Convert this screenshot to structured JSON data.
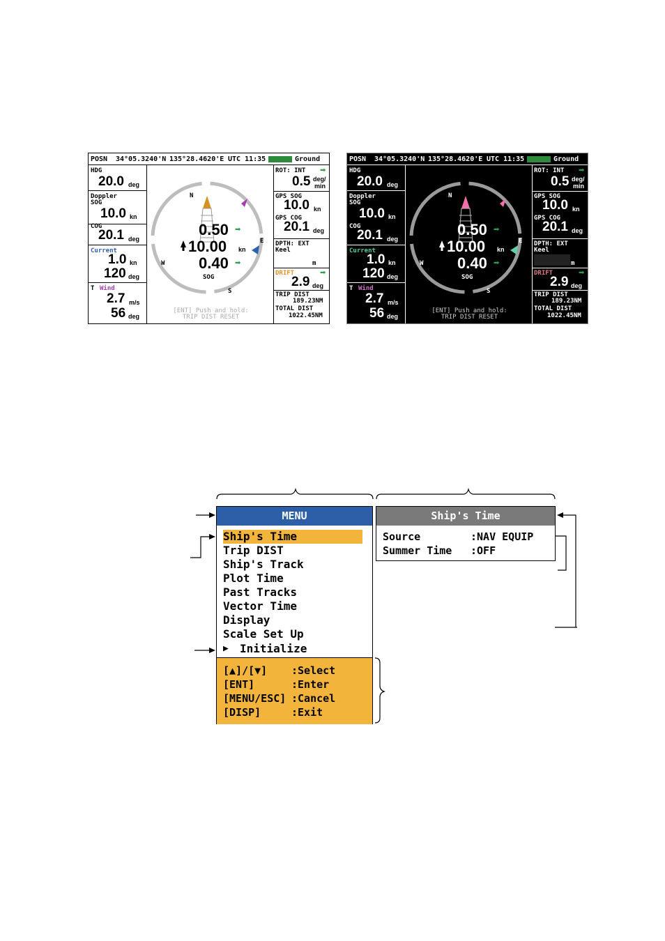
{
  "header": {
    "posn_label": "POSN",
    "lat": "34°05.3240'N",
    "lon": "135°28.4620'E",
    "utc": "UTC 11:35",
    "mode": "Ground"
  },
  "left_panel": {
    "hdg": {
      "label": "HDG",
      "value": "20.0",
      "unit": "deg"
    },
    "doppler_sog": {
      "label1": "Doppler",
      "label2": "SOG",
      "value": "10.0",
      "unit": "kn"
    },
    "cog": {
      "label": "COG",
      "value": "20.1",
      "unit": "deg"
    },
    "current": {
      "label": "Current",
      "speed": "1.0",
      "speed_unit": "kn",
      "dir": "120",
      "dir_unit": "deg"
    },
    "t_wind": {
      "label_t": "T",
      "label_wind": "Wind",
      "speed": "2.7",
      "speed_unit": "m/s",
      "dir": "56",
      "dir_unit": "deg"
    }
  },
  "compass": {
    "n": "N",
    "e": "E",
    "s": "S",
    "w": "W",
    "v1": "0.50",
    "v2": "10.00",
    "v2_unit": "kn",
    "v3": "0.40",
    "sog_label": "SOG",
    "note1": "[ENT] Push and hold:",
    "note2": "TRIP DIST RESET"
  },
  "right_panel": {
    "rot": {
      "label": "ROT: INT",
      "value": "0.5",
      "unit_top": "deg/",
      "unit_bottom": "min"
    },
    "gps_sog": {
      "label": "GPS SOG",
      "value": "10.0",
      "unit": "kn"
    },
    "gps_cog": {
      "label": "GPS COG",
      "value": "20.1",
      "unit": "deg"
    },
    "dpth": {
      "label": "DPTH: EXT",
      "sub": "Keel",
      "unit": "m"
    },
    "drift": {
      "label": "DRIFT",
      "value": "2.9",
      "unit": "deg"
    },
    "trip": {
      "label": "TRIP DIST",
      "value": "189.23NM"
    },
    "total": {
      "label": "TOTAL DIST",
      "value": "1022.45NM"
    }
  },
  "menu": {
    "title": "MENU",
    "items": [
      "Ship's Time",
      "Trip DIST",
      "Ship's Track",
      "Plot Time",
      "Past Tracks",
      "Vector Time",
      "Display",
      "Scale Set Up",
      "Initialize"
    ],
    "help": [
      {
        "key": "[▲]/[▼]",
        "action": ":Select"
      },
      {
        "key": "[ENT]",
        "action": ":Enter"
      },
      {
        "key": "[MENU/ESC]",
        "action": ":Cancel"
      },
      {
        "key": "[DISP]",
        "action": ":Exit"
      }
    ]
  },
  "submenu": {
    "title": "Ship's Time",
    "rows": [
      {
        "key": "Source",
        "value": ":NAV EQUIP"
      },
      {
        "key": "Summer Time",
        "value": ":OFF"
      }
    ]
  },
  "colors": {
    "menu_title_bg": "#2c5fa8",
    "menu_highlight": "#f2b43a",
    "submenu_title_bg": "#7a7a7a",
    "ground_bar": "#2e8b3e",
    "green_arrow": "#2ea04a",
    "current_day": "#2f5fb0",
    "current_night": "#4ad29a",
    "wind": "#a040a8",
    "drift_day": "#e0922c",
    "drift_night": "#e07a7a"
  }
}
